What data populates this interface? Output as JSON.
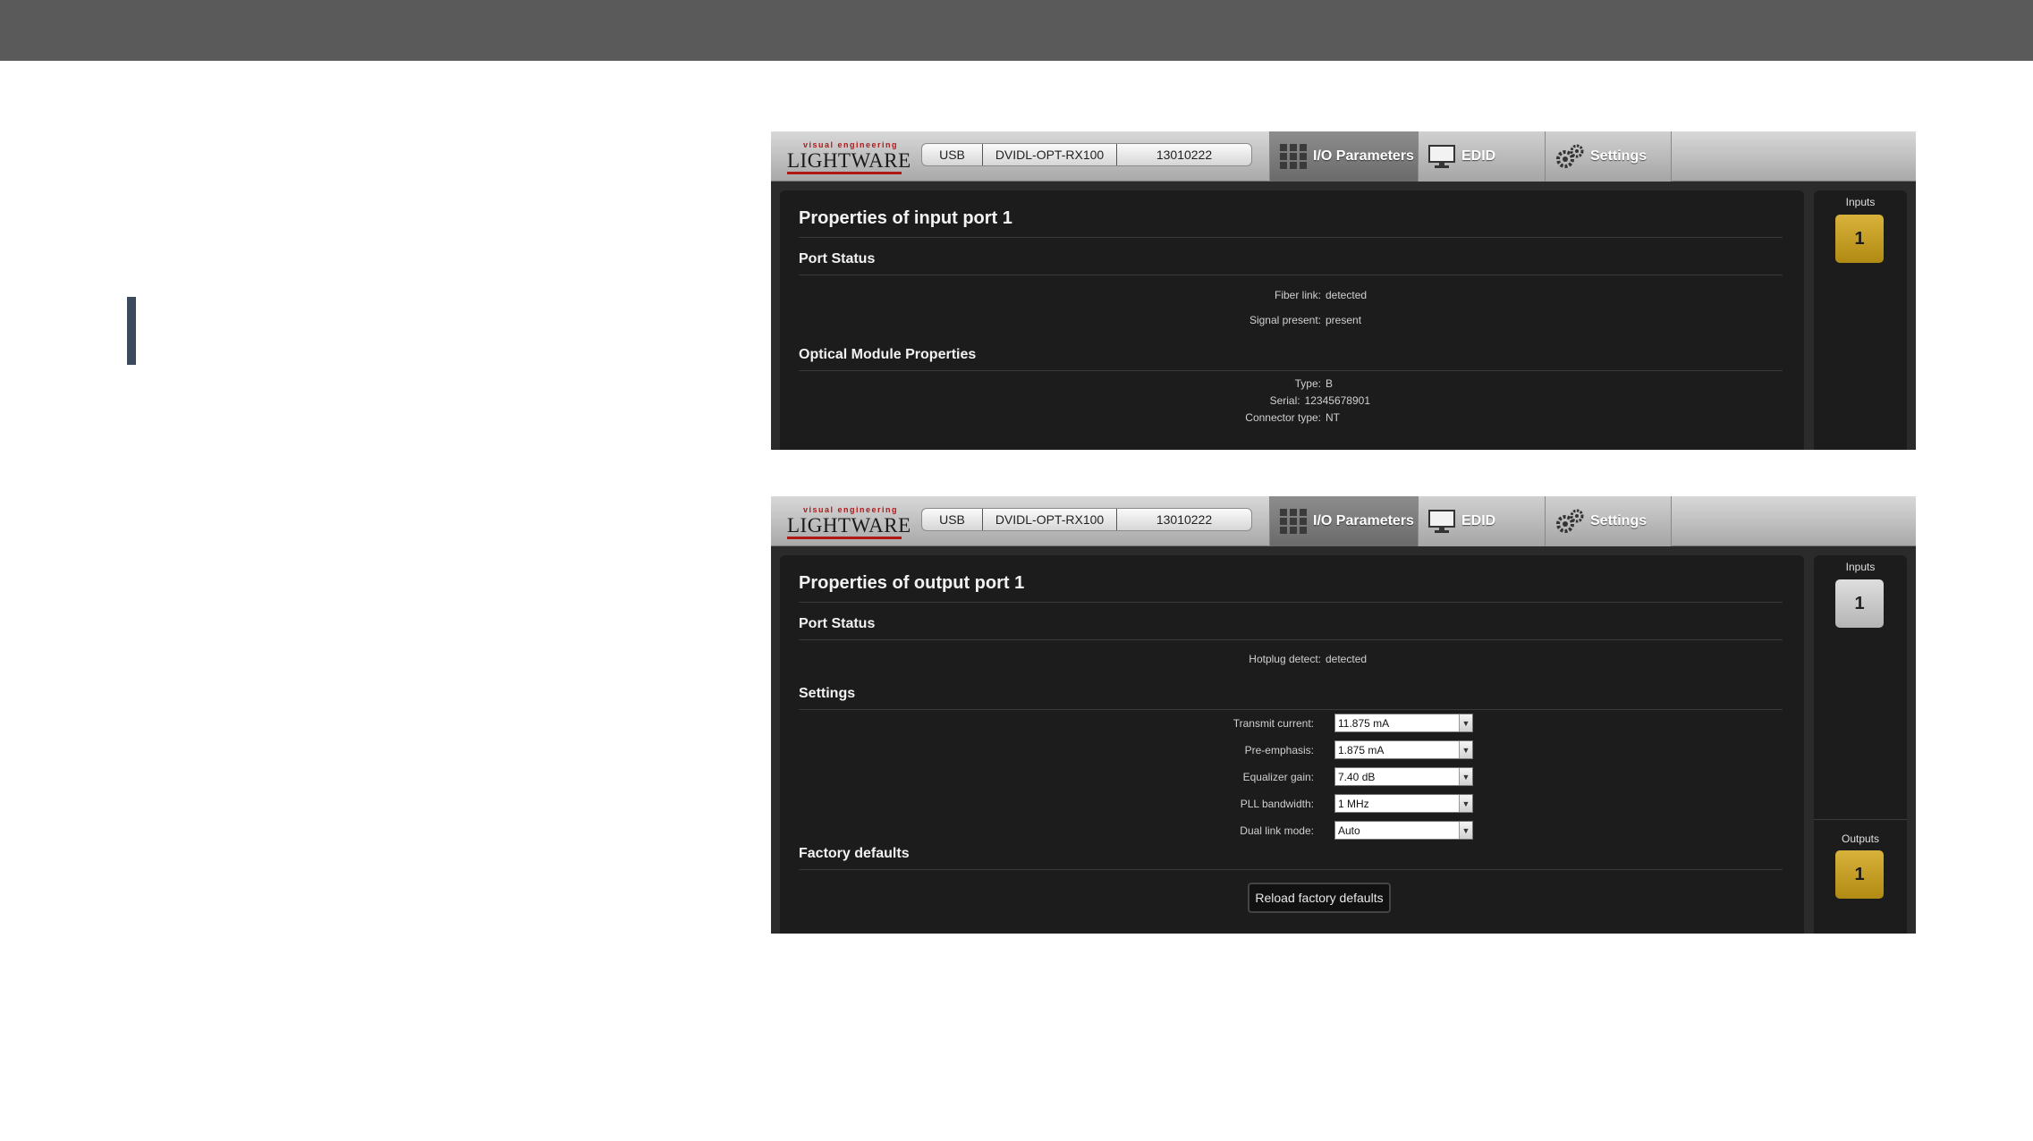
{
  "windows": [
    {
      "header": {
        "logo_tag": "visual engineering",
        "logo_word": "LIGHTWARE",
        "connection": "USB",
        "model": "DVIDL-OPT-RX100",
        "serial": "13010222",
        "tabs": {
          "io": "I/O Parameters",
          "edid": "EDID",
          "settings": "Settings"
        }
      },
      "title": "Properties of input port 1",
      "port_status": {
        "heading": "Port Status",
        "rows": [
          {
            "label": "Fiber link:",
            "value": "detected"
          },
          {
            "label": "Signal present:",
            "value": "present"
          }
        ]
      },
      "optical": {
        "heading": "Optical Module Properties",
        "rows": [
          {
            "label": "Type:",
            "value": "B"
          },
          {
            "label": "Serial:",
            "value": "12345678901"
          },
          {
            "label": "Connector type:",
            "value": "NT"
          }
        ]
      },
      "side": {
        "inputs_label": "Inputs",
        "input_port": "1",
        "input_selected": true
      }
    },
    {
      "header": {
        "logo_tag": "visual engineering",
        "logo_word": "LIGHTWARE",
        "connection": "USB",
        "model": "DVIDL-OPT-RX100",
        "serial": "13010222",
        "tabs": {
          "io": "I/O Parameters",
          "edid": "EDID",
          "settings": "Settings"
        }
      },
      "title": "Properties of output port 1",
      "port_status": {
        "heading": "Port Status",
        "rows": [
          {
            "label": "Hotplug detect:",
            "value": "detected"
          }
        ]
      },
      "settings": {
        "heading": "Settings",
        "rows": [
          {
            "label": "Transmit current:",
            "value": "11.875 mA"
          },
          {
            "label": "Pre-emphasis:",
            "value": "1.875 mA"
          },
          {
            "label": "Equalizer gain:",
            "value": "7.40 dB"
          },
          {
            "label": "PLL bandwidth:",
            "value": "1 MHz"
          },
          {
            "label": "Dual link mode:",
            "value": "Auto"
          }
        ]
      },
      "factory": {
        "heading": "Factory defaults",
        "button": "Reload factory defaults"
      },
      "side": {
        "inputs_label": "Inputs",
        "input_port": "1",
        "input_selected": false,
        "outputs_label": "Outputs",
        "output_port": "1",
        "output_selected": true
      }
    }
  ],
  "colors": {
    "accent_port": "#c9a12a",
    "panel_bg": "#1c1c1c",
    "top_band": "#5a5a5a",
    "side_marker": "#3b4a5c"
  }
}
